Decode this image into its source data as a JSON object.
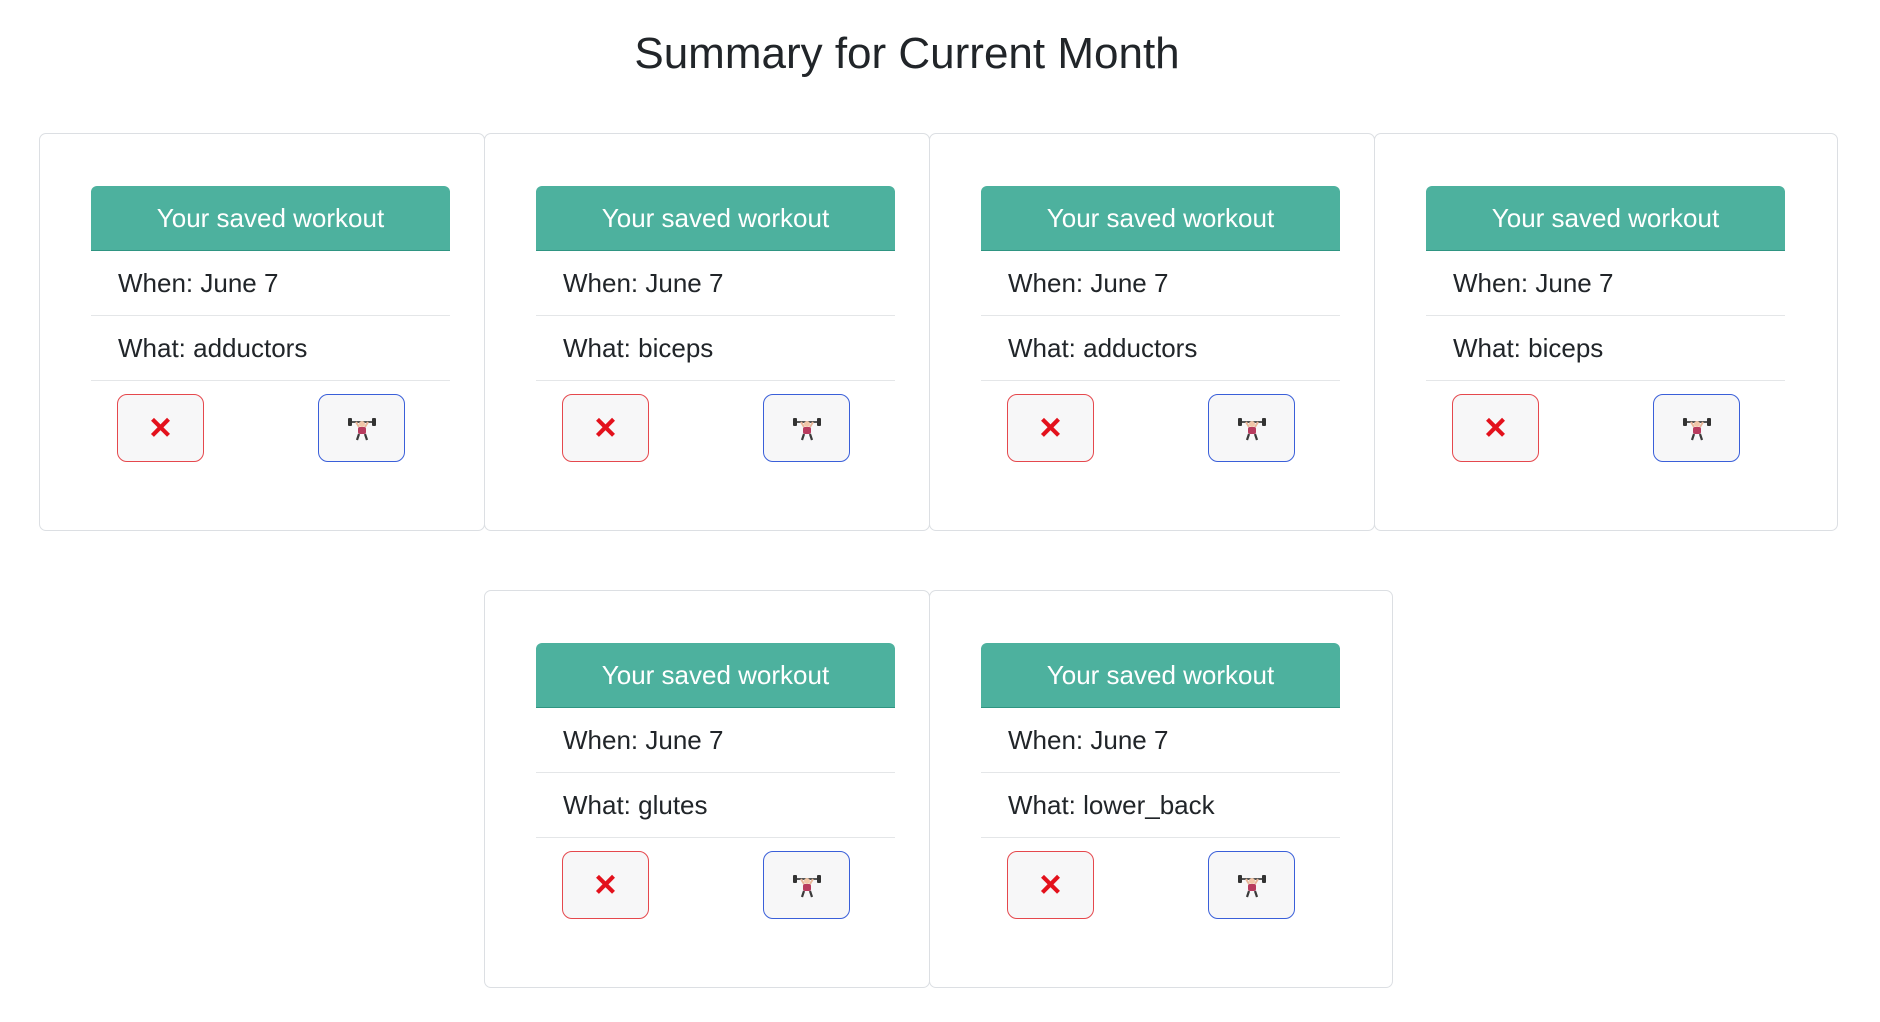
{
  "page": {
    "title": "Summary for Current Month"
  },
  "icons": {
    "delete": "×",
    "delete_icon_name": "cross-mark-icon",
    "workout_icon_name": "weight-lifter-icon"
  },
  "colors": {
    "header_bg": "#4db19e",
    "delete_border": "#e5484d",
    "workout_border": "#3a5fd9",
    "delete_icon": "#e3111c"
  },
  "workouts": [
    {
      "header": "Your saved workout",
      "when": "When: June 7",
      "what": "What: adductors"
    },
    {
      "header": "Your saved workout",
      "when": "When: June 7",
      "what": "What: biceps"
    },
    {
      "header": "Your saved workout",
      "when": "When: June 7",
      "what": "What: adductors"
    },
    {
      "header": "Your saved workout",
      "when": "When: June 7",
      "what": "What: biceps"
    },
    {
      "header": "Your saved workout",
      "when": "When: June 7",
      "what": "What: glutes"
    },
    {
      "header": "Your saved workout",
      "when": "When: June 7",
      "what": "What: lower_back"
    }
  ]
}
